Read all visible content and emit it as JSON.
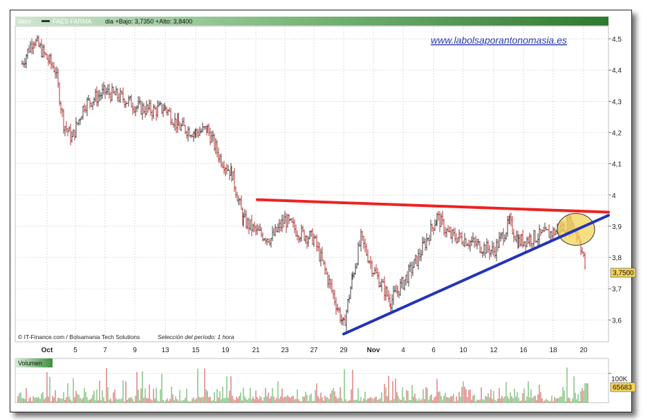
{
  "header": {
    "valor_label": "Valor",
    "symbol": "FAES FARMA",
    "info": "dia +Bajo: 3,7350 +Alto: 3,8400"
  },
  "watermark": "www.labolsaporantonomasia.es",
  "source": "© IT-Finance.com / Bolsamania Tech Solutions",
  "period": "Selección del período: 1 hora",
  "last_price_badge": "3,7500",
  "volume_panel": {
    "label": "Volumen",
    "axis_label": "100K",
    "last_volume_badge": "65683"
  },
  "colors": {
    "price_bar": "#2b2b2b",
    "price_bar_red": "#b02020",
    "resistance": "#ee2222",
    "support": "#2233bb",
    "highlight": "#f3d35a",
    "grid": "#c8c8c8",
    "volume_red": "#cc4444",
    "volume_green": "#44aa44",
    "header_green": "#3f8f3f"
  },
  "chart_data": {
    "type": "candlestick",
    "title": "FAES FARMA",
    "y_ticks": [
      "4,5",
      "4,4",
      "4,3",
      "4,2",
      "4,1",
      "4",
      "3,9",
      "3,8",
      "3,7",
      "3,6"
    ],
    "ylim": [
      3.53,
      4.54
    ],
    "x_ticks": [
      "Oct",
      "5",
      "7",
      "9",
      "13",
      "15",
      "19",
      "21",
      "23",
      "27",
      "29",
      "Nov",
      "4",
      "6",
      "10",
      "12",
      "16",
      "18",
      "20"
    ],
    "price_path": [
      {
        "x": "Oct 1",
        "y": 4.42
      },
      {
        "x": "Oct 2",
        "y": 4.5
      },
      {
        "x": "Oct 3",
        "y": 4.4
      },
      {
        "x": "Oct 4",
        "y": 4.23
      },
      {
        "x": "Oct 5",
        "y": 4.18
      },
      {
        "x": "Oct 6",
        "y": 4.29
      },
      {
        "x": "Oct 7",
        "y": 4.33
      },
      {
        "x": "Oct 8",
        "y": 4.31
      },
      {
        "x": "Oct 9",
        "y": 4.28
      },
      {
        "x": "Oct 12",
        "y": 4.27
      },
      {
        "x": "Oct 13",
        "y": 4.28
      },
      {
        "x": "Oct 14",
        "y": 4.22
      },
      {
        "x": "Oct 15",
        "y": 4.2
      },
      {
        "x": "Oct 16",
        "y": 4.21
      },
      {
        "x": "Oct 17",
        "y": 4.12
      },
      {
        "x": "Oct 19",
        "y": 4.07
      },
      {
        "x": "Oct 20",
        "y": 3.92
      },
      {
        "x": "Oct 21",
        "y": 3.88
      },
      {
        "x": "Oct 22",
        "y": 3.86
      },
      {
        "x": "Oct 23",
        "y": 3.92
      },
      {
        "x": "Oct 26",
        "y": 3.88
      },
      {
        "x": "Oct 27",
        "y": 3.86
      },
      {
        "x": "Oct 28",
        "y": 3.72
      },
      {
        "x": "Oct 29",
        "y": 3.58
      },
      {
        "x": "Oct 30",
        "y": 3.74
      },
      {
        "x": "Oct 31",
        "y": 3.86
      },
      {
        "x": "Nov 2",
        "y": 3.76
      },
      {
        "x": "Nov 3",
        "y": 3.66
      },
      {
        "x": "Nov 4",
        "y": 3.72
      },
      {
        "x": "Nov 5",
        "y": 3.8
      },
      {
        "x": "Nov 6",
        "y": 3.93
      },
      {
        "x": "Nov 8",
        "y": 3.87
      },
      {
        "x": "Nov 10",
        "y": 3.86
      },
      {
        "x": "Nov 11",
        "y": 3.84
      },
      {
        "x": "Nov 12",
        "y": 3.82
      },
      {
        "x": "Nov 14",
        "y": 3.91
      },
      {
        "x": "Nov 15",
        "y": 3.85
      },
      {
        "x": "Nov 16",
        "y": 3.86
      },
      {
        "x": "Nov 18",
        "y": 3.88
      },
      {
        "x": "Nov 19",
        "y": 3.91
      },
      {
        "x": "Nov 19b",
        "y": 3.86
      },
      {
        "x": "Nov 20",
        "y": 3.75
      }
    ],
    "resistance_line": {
      "from": {
        "x": "Oct 21",
        "y": 3.985
      },
      "to": {
        "x": "Nov 21",
        "y": 3.945
      }
    },
    "support_line": {
      "from": {
        "x": "Oct 29",
        "y": 3.555
      },
      "to": {
        "x": "Nov 21",
        "y": 3.935
      }
    },
    "highlight_ellipse": {
      "x": "Nov 19",
      "y": 3.89
    },
    "last_price": 3.75,
    "volume": {
      "ylim": [
        0,
        150000
      ],
      "tick": 100000,
      "last": 65683
    }
  }
}
